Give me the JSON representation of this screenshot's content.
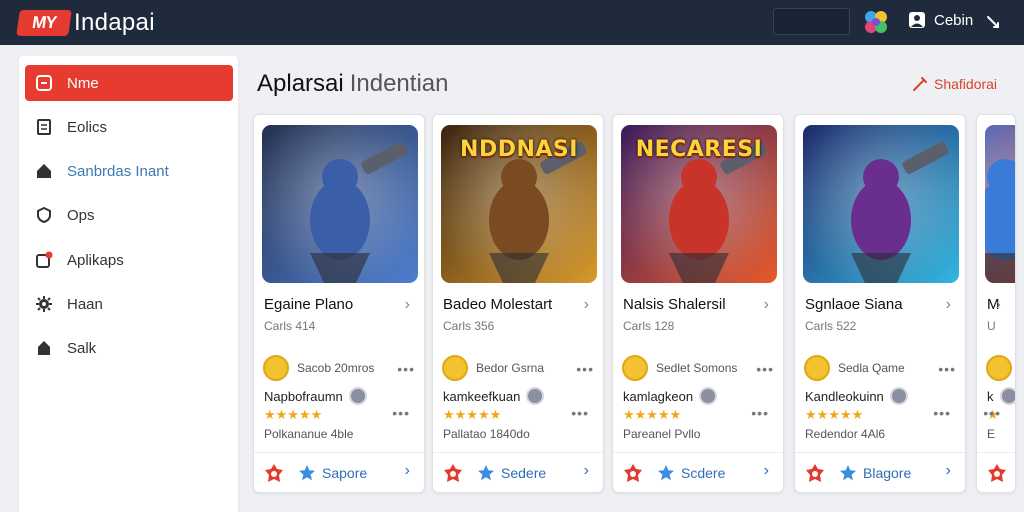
{
  "app": {
    "logo_mark": "MY",
    "title": "Indapai",
    "user_label": "Cebin"
  },
  "sidebar": {
    "items": [
      {
        "label": "Nme",
        "icon": "home-card-icon",
        "active": true
      },
      {
        "label": "Eolics",
        "icon": "document-icon"
      },
      {
        "label": "Sanbrdas Inant",
        "icon": "house-icon",
        "link": true
      },
      {
        "label": "Ops",
        "icon": "shield-icon"
      },
      {
        "label": "Aplikaps",
        "icon": "apps-badge-icon"
      },
      {
        "label": "Haan",
        "icon": "gear-icon"
      },
      {
        "label": "Salk",
        "icon": "lock-icon"
      }
    ]
  },
  "main": {
    "title": "Aplarsai",
    "title_sub": "Indentian",
    "header_action": "Shafidorai"
  },
  "cards": [
    {
      "art_text": "",
      "title": "Egaine Plano",
      "meta": "Carls 414",
      "publisher": "Sacob 20mros",
      "reviewer": "Napbofraumn",
      "stars": "★★★★★",
      "footer": "Polkananue 4ble",
      "action": "Sapore",
      "colors": {
        "bg1": "#24304f",
        "bg2": "#4f7fd0",
        "hero": "#3a5ea8"
      }
    },
    {
      "art_text": "NDDNASI",
      "title": "Badeo Molestart",
      "meta": "Carls 356",
      "publisher": "Bedor Gsrna",
      "reviewer": "kamkeefkuan",
      "stars": "★★★★★",
      "footer": "Pallatao 1840do",
      "action": "Sedere",
      "colors": {
        "bg1": "#3b2411",
        "bg2": "#d99a2b",
        "hero": "#7a4a22"
      }
    },
    {
      "art_text": "NECARESI",
      "title": "Nalsis Shalersil",
      "meta": "Carls 128",
      "publisher": "Sedlet Somons",
      "reviewer": "kamlagkeon",
      "stars": "★★★★★",
      "footer": "Pareanel Pvllo",
      "action": "Scdere",
      "colors": {
        "bg1": "#3a1c5e",
        "bg2": "#e85a2a",
        "hero": "#c8332a"
      }
    },
    {
      "art_text": "",
      "title": "Sgnlaoe Siana",
      "meta": "Carls 522",
      "publisher": "Sedla Qame",
      "reviewer": "Kandleokuinn",
      "stars": "★★★★★",
      "footer": "Redendor 4Al6",
      "action": "Blagore",
      "colors": {
        "bg1": "#1e2a6b",
        "bg2": "#33b6e0",
        "hero": "#6a2f8e"
      }
    },
    {
      "art_text": "",
      "title": "M",
      "meta": "U",
      "publisher": "",
      "reviewer": "k",
      "stars": "★",
      "footer": "E",
      "action": "",
      "colors": {
        "bg1": "#2a5fcc",
        "bg2": "#d94a2a",
        "hero": "#3a7ad8"
      }
    }
  ]
}
